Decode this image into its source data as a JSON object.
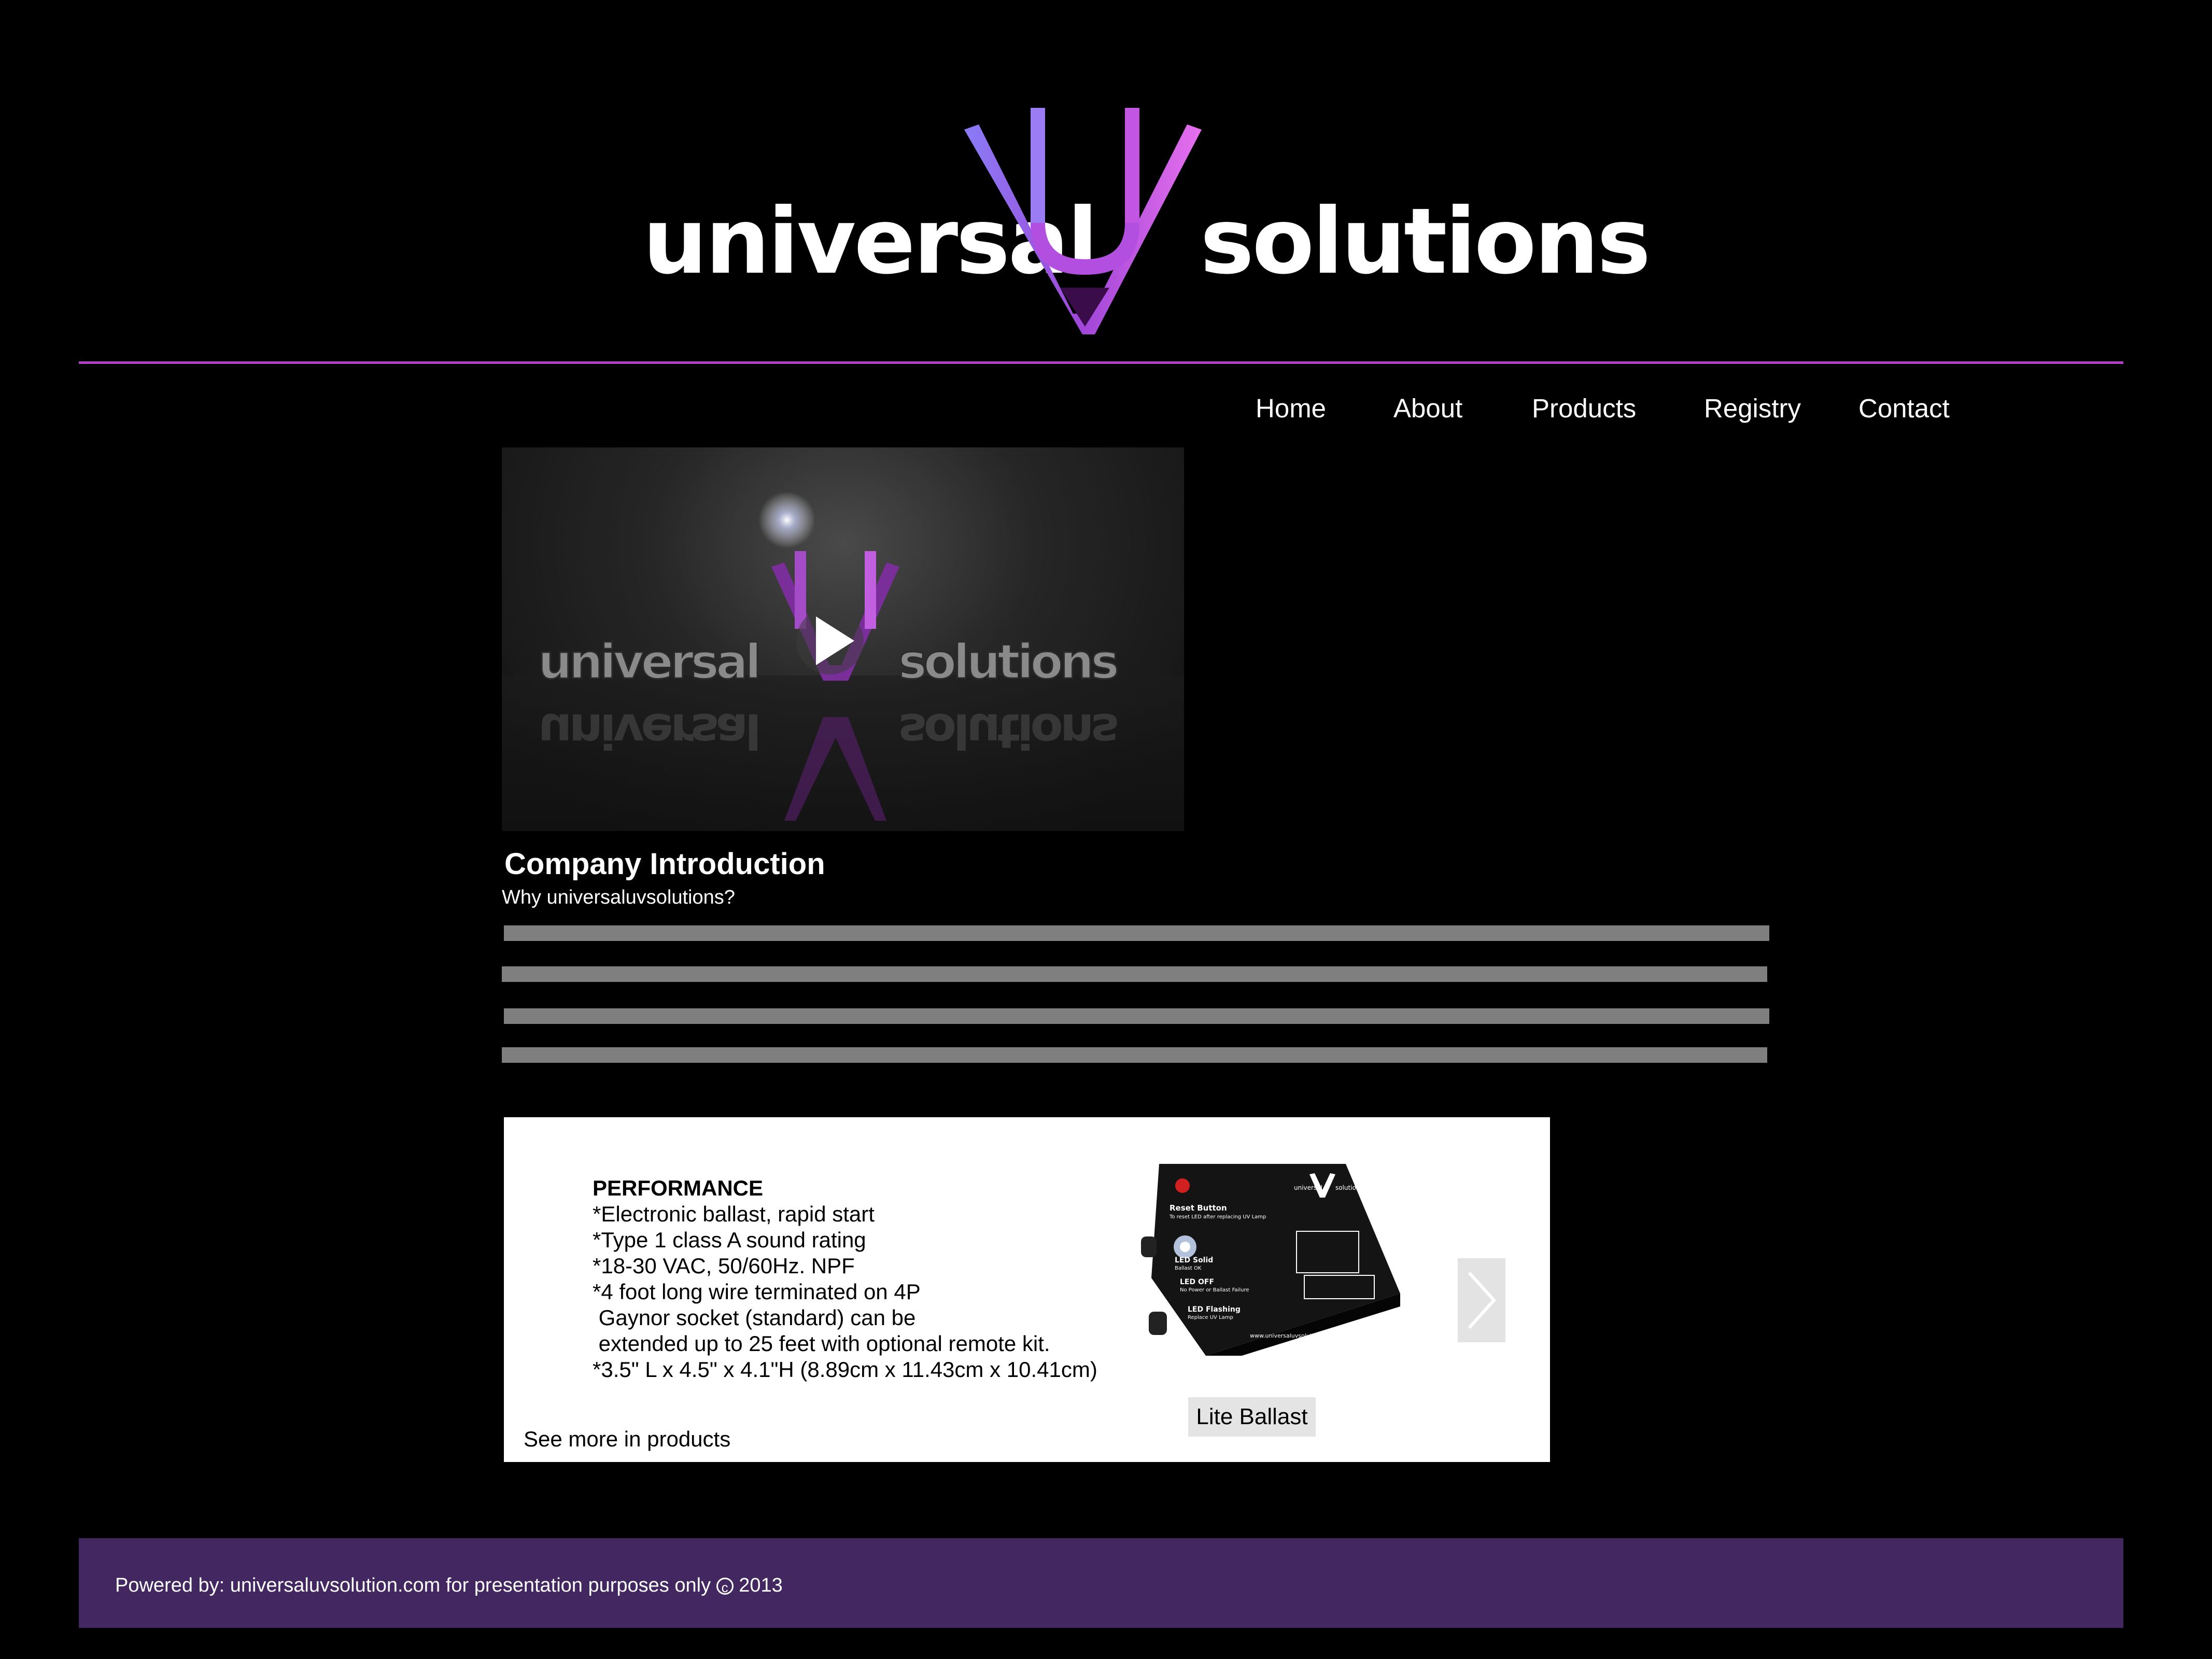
{
  "logo": {
    "left_word": "universal",
    "right_word": "solutions",
    "mark_icon": "uv-logo-mark-icon"
  },
  "nav": {
    "items": [
      {
        "label": "Home"
      },
      {
        "label": "About"
      },
      {
        "label": "Products"
      },
      {
        "label": "Registry"
      },
      {
        "label": "Contact"
      }
    ]
  },
  "video": {
    "play_icon": "play-icon"
  },
  "intro": {
    "title": "Company Introduction",
    "subtitle": "Why universaluvsolutions?"
  },
  "slider": {
    "performance_title": "PERFORMANCE",
    "specs": [
      "*Electronic ballast, rapid start",
      "*Type 1 class A sound rating",
      "*18-30 VAC, 50/60Hz. NPF",
      "*4 foot long wire terminated on 4P",
      " Gaynor socket (standard) can be",
      " extended up to 25 feet with optional remote kit.",
      "*3.5\" L x 4.5\" x 4.1\"H (8.89cm x 11.43cm x 10.41cm)"
    ],
    "product_caption": "Lite Ballast",
    "see_more": "See more in products",
    "next_icon": "chevron-right-icon",
    "product_label": {
      "reset": "Reset Button",
      "reset_note": "To reset LED after replacing UV Lamp",
      "led_solid": "LED Solid",
      "led_solid_note": "Ballast OK",
      "led_off": "LED OFF",
      "led_off_note": "No Power or Ballast Failure",
      "led_flashing": "LED Flashing",
      "led_flashing_note": "Replace UV Lamp",
      "url": "www.universaluvsolutions.com"
    }
  },
  "footer": {
    "text_before": "Powered by: universaluvsolution.com for presentation purposes only ",
    "copyright_symbol": "c",
    "year": " 2013"
  },
  "colors": {
    "background": "#000000",
    "divider": "#b03fc6",
    "footer": "#432760",
    "text_bar": "#7f7f7f",
    "logo_purple": "#c84ee0",
    "logo_violet": "#8a6cf0"
  }
}
